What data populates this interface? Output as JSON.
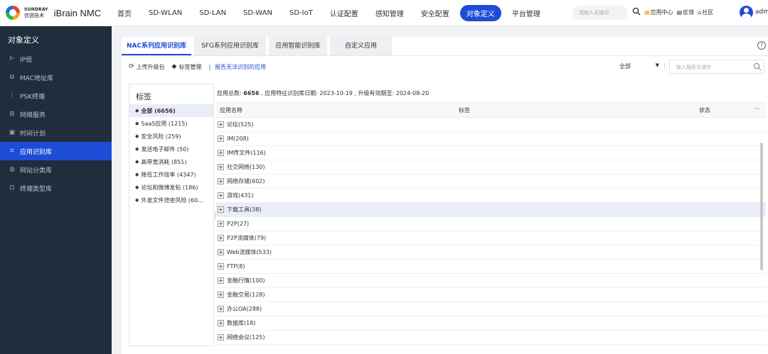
{
  "brand": {
    "logo_en": "SUNDRAY",
    "logo_cn": "信锐技术",
    "product": "iBrain NMC"
  },
  "nav": {
    "items": [
      "首页",
      "SD-WLAN",
      "SD-LAN",
      "SD-WAN",
      "SD-IoT",
      "认证配置",
      "感知管理",
      "安全配置",
      "对象定义",
      "平台管理"
    ],
    "active_index": 8
  },
  "header": {
    "search_placeholder": "请输入关键词",
    "app_center": "应用中心",
    "feedback": "反馈",
    "community": "社区",
    "user": "adm"
  },
  "sidebar": {
    "title": "对象定义",
    "items": [
      {
        "label": "IP组",
        "icon": "ip-group-icon",
        "glyph": "⊩"
      },
      {
        "label": "MAC地址库",
        "icon": "mac-icon",
        "glyph": "⧉"
      },
      {
        "label": "PSK终端",
        "icon": "psk-icon",
        "glyph": "⁝"
      },
      {
        "label": "网络服务",
        "icon": "network-service-icon",
        "glyph": "⊞"
      },
      {
        "label": "时间计划",
        "icon": "calendar-icon",
        "glyph": "▣"
      },
      {
        "label": "应用识别库",
        "icon": "app-recognition-icon",
        "glyph": "⌗",
        "active": true
      },
      {
        "label": "网站分类库",
        "icon": "website-category-icon",
        "glyph": "◍"
      },
      {
        "label": "终端类型库",
        "icon": "terminal-type-icon",
        "glyph": "⊡"
      }
    ]
  },
  "tabs": [
    "NAC系列应用识别库",
    "SFG系列应用识别库",
    "应用智能识别库",
    "自定义应用"
  ],
  "toolbar": {
    "upload": "上传升级包",
    "tag_manage": "标签管理",
    "report": "报告无法识别的应用",
    "filter_value": "全部",
    "search_placeholder": "输入搜索关键字"
  },
  "tag_panel": {
    "title": "标签",
    "items": [
      {
        "label": "全部 (6656)",
        "active": true
      },
      {
        "label": "SaaS应用 (1215)"
      },
      {
        "label": "安全风险 (259)"
      },
      {
        "label": "发送电子邮件 (50)"
      },
      {
        "label": "高带宽消耗 (851)"
      },
      {
        "label": "降低工作效率 (4347)"
      },
      {
        "label": "论坛和微博发帖 (186)"
      },
      {
        "label": "外发文件泄密风险 (60..."
      }
    ]
  },
  "summary": {
    "prefix": "应用总数:",
    "total": "6656",
    "rest": ", 应用特征识别库日期: 2023-10-19 , 升级有效期至: 2024-08-20"
  },
  "table": {
    "columns": {
      "name": "应用名称",
      "tag": "标签",
      "status": "状态",
      "more": "···"
    },
    "rows": [
      {
        "label": "论坛(525)"
      },
      {
        "label": "IM(208)"
      },
      {
        "label": "IM传文件(116)"
      },
      {
        "label": "社交网络(130)"
      },
      {
        "label": "网络存储(602)"
      },
      {
        "label": "游戏(431)"
      },
      {
        "label": "下载工具(38)",
        "highlight": true
      },
      {
        "label": "P2P(27)"
      },
      {
        "label": "P2P流媒体(79)"
      },
      {
        "label": "Web流媒体(533)"
      },
      {
        "label": "FTP(8)"
      },
      {
        "label": "金融行情(100)"
      },
      {
        "label": "金融交易(128)"
      },
      {
        "label": "办公OA(288)"
      },
      {
        "label": "数据库(18)"
      },
      {
        "label": "网络会议(125)"
      }
    ]
  },
  "colors": {
    "accent": "#1e4cd7",
    "sidebar_bg": "#1f2d3d",
    "selected_row": "#e8edf7"
  }
}
